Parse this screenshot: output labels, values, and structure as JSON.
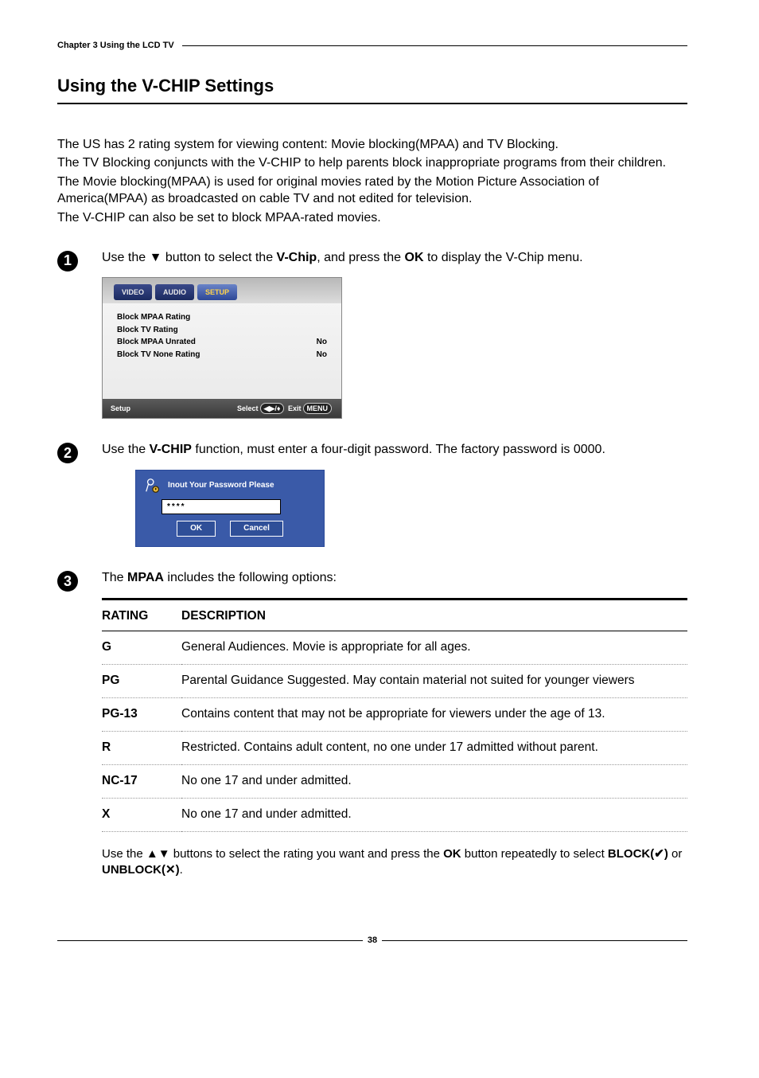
{
  "chapter": "Chapter 3 Using the LCD TV",
  "section_title": "Using  the V-CHIP Settings",
  "intro": {
    "p1": "The US has 2 rating system for viewing content: Movie blocking(MPAA) and TV Blocking.",
    "p2": "The TV Blocking conjuncts with the V-CHIP  to help parents block inappropriate programs from their children.",
    "p3": "The Movie blocking(MPAA) is used for original movies rated by the Motion Picture Association of America(MPAA) as broadcasted on cable TV and not edited for television.",
    "p4": "The V-CHIP can also be set to block MPAA-rated movies."
  },
  "step1": {
    "pre": "Use the ",
    "arrow": "▼",
    "mid": " button to select the ",
    "bold1": "V-Chip",
    "mid2": ",  and press the ",
    "bold2": "OK",
    "post": " to display the V-Chip menu."
  },
  "osd": {
    "tabs": {
      "video": "VIDEO",
      "audio": "AUDIO",
      "setup": "SETUP"
    },
    "rows": [
      {
        "label": "Block MPAA Rating",
        "value": ""
      },
      {
        "label": "Block TV Rating",
        "value": ""
      },
      {
        "label": "Block MPAA Unrated",
        "value": "No"
      },
      {
        "label": "Block TV None Rating",
        "value": "No"
      }
    ],
    "footer_left": "Setup",
    "footer_select": "Select",
    "footer_nav": "◀▶/♦",
    "footer_exit": "Exit",
    "footer_menu": "MENU"
  },
  "step2": {
    "pre": "Use the ",
    "bold": "V-CHIP",
    "post": " function, must enter a four-digit password. The factory password is 0000."
  },
  "pw": {
    "title": "Inout Your Password Please",
    "value": "****",
    "ok": "OK",
    "cancel": "Cancel"
  },
  "step3": {
    "pre": "The ",
    "bold": "MPAA",
    "post": " includes the following options:"
  },
  "table": {
    "head_rating": "RATING",
    "head_desc": "DESCRIPTION",
    "rows": [
      {
        "rating": "G",
        "desc": "General Audiences.  Movie is appropriate for all ages."
      },
      {
        "rating": "PG",
        "desc": "Parental Guidance Suggested. May contain material not suited for younger viewers"
      },
      {
        "rating": "PG-13",
        "desc": "Contains content that may not be appropriate for viewers under the age of 13."
      },
      {
        "rating": "R",
        "desc": "Restricted. Contains adult content, no one under 17 admitted without parent."
      },
      {
        "rating": "NC-17",
        "desc": "No one 17 and under admitted."
      },
      {
        "rating": "X",
        "desc": "No one 17 and under admitted."
      }
    ]
  },
  "after": {
    "pre": "Use the ",
    "arrows": "▲▼",
    "mid": " buttons to select the rating you want and press the ",
    "ok": "OK",
    "mid2": " button repeatedly to select ",
    "block": "BLOCK(",
    "check": "✔",
    "block_close": ")",
    "or": " or ",
    "unblock": "UNBLOCK(",
    "x": "✕",
    "unblock_close": ")",
    "period": "."
  },
  "page_number": "38"
}
